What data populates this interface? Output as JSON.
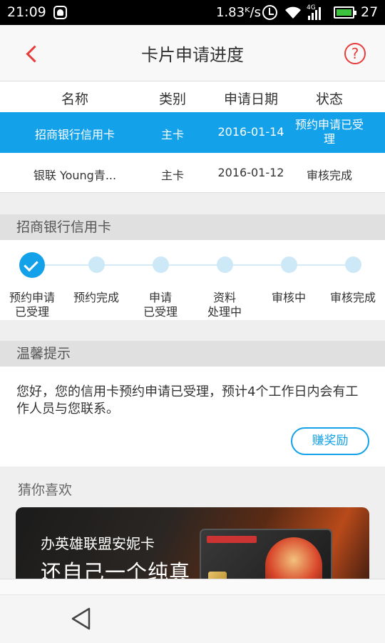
{
  "status_bar": {
    "time": "21:09",
    "speed": "1.83ᴷ/s",
    "network": "4G",
    "battery": "27"
  },
  "header": {
    "title": "卡片申请进度"
  },
  "table": {
    "headers": [
      "名称",
      "类别",
      "申请日期",
      "状态"
    ],
    "rows": [
      {
        "name": "招商银行信用卡",
        "type": "主卡",
        "date": "2016-01-14",
        "status": "预约申请已受理",
        "selected": true
      },
      {
        "name": "银联 Young青...",
        "type": "主卡",
        "date": "2016-01-12",
        "status": "审核完成",
        "selected": false
      }
    ]
  },
  "progress": {
    "section_title": "招商银行信用卡",
    "steps": [
      {
        "label": "预约申请\n已受理",
        "done": true
      },
      {
        "label": "预约完成",
        "done": false
      },
      {
        "label": "申请\n已受理",
        "done": false
      },
      {
        "label": "资料\n处理中",
        "done": false
      },
      {
        "label": "审核中",
        "done": false
      },
      {
        "label": "审核完成",
        "done": false
      }
    ]
  },
  "tip": {
    "section_title": "温馨提示",
    "text": "您好，您的信用卡预约申请已受理，预计4个工作日内会有工作人员与您联系。",
    "button": "赚奖励"
  },
  "recommend": {
    "title": "猜你喜欢",
    "banner_line1": "办英雄联盟安妮卡",
    "banner_line2": "还自己一个纯真"
  },
  "colors": {
    "accent": "#13a1ea",
    "brand_red": "#e63c3c"
  }
}
